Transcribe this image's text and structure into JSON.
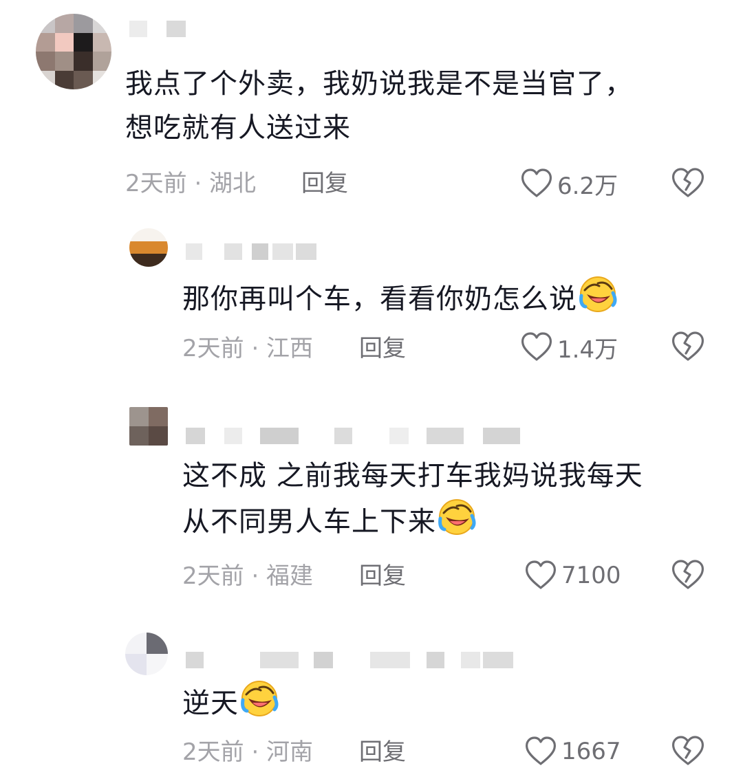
{
  "comments": [
    {
      "text": "我点了个外卖，我奶说我是不是当官了，\n想吃就有人送过来",
      "meta": "2天前 · 湖北",
      "reply_label": "回复",
      "likes": "6.2万",
      "has_emoji": false
    },
    {
      "text": "那你再叫个车，看看你奶怎么说",
      "meta": "2天前 · 江西",
      "reply_label": "回复",
      "likes": "1.4万",
      "has_emoji": true
    },
    {
      "text": "这不成 之前我每天打车我妈说我每天\n从不同男人车上下来",
      "meta": "2天前 · 福建",
      "reply_label": "回复",
      "likes": "7100",
      "has_emoji": true
    },
    {
      "text": "逆天",
      "meta": "2天前 · 河南",
      "reply_label": "回复",
      "likes": "1667",
      "has_emoji": true
    }
  ],
  "icons": {
    "like": "heart-outline-icon",
    "dislike": "broken-heart-icon",
    "emoji": "rolling-on-floor-laughing-emoji"
  },
  "colors": {
    "text": "#161823",
    "meta": "#a3a3a8",
    "action": "#6e6e73",
    "blur": "#e6e6e6"
  }
}
